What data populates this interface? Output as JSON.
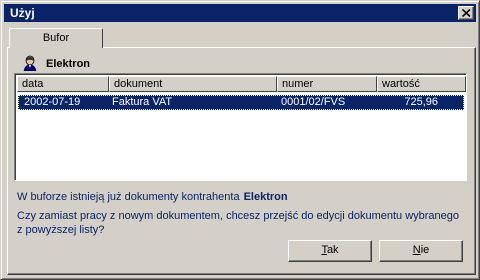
{
  "window": {
    "title": "Użyj"
  },
  "tabs": [
    {
      "label": "Bufor"
    }
  ],
  "contractor": {
    "name": "Elektron",
    "icon": "person-icon"
  },
  "table": {
    "columns": [
      "data",
      "dokument",
      "numer",
      "wartość"
    ],
    "rows": [
      {
        "data": "2002-07-19",
        "dokument": "Faktura VAT",
        "numer": "0001/02/FVS",
        "wartosc": "725,96"
      }
    ]
  },
  "message": {
    "line1_prefix": "W buforze istnieją już dokumenty kontrahenta",
    "line1_name": "Elektron",
    "line2": "Czy zamiast pracy z nowym dokumentem, chcesz przejść do edycji dokumentu wybranego z powyższej listy?"
  },
  "buttons": {
    "yes_first": "T",
    "yes_rest": "ak",
    "no_first": "N",
    "no_rest": "ie"
  },
  "colors": {
    "titlebar": "#0a246a",
    "selection": "#0a246a",
    "face": "#d4d0c8"
  }
}
